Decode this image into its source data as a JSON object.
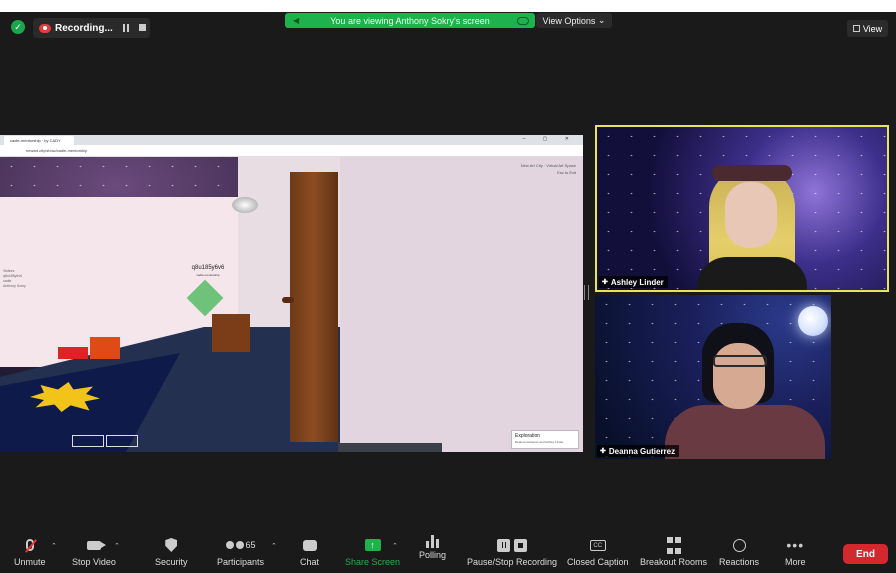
{
  "meeting": {
    "recording_label": "Recording...",
    "view_banner": "You are viewing Anthony Sokry's screen",
    "view_options": "View Options",
    "view_label": "View"
  },
  "shared_screen": {
    "tab_title": "cadie-mentorship · by CADY",
    "url": "newart.city/show/cadie-mentorship",
    "avatar_name": "q8u185y6v6",
    "avatar_sub": "cadie-mentorship",
    "hud_text": "New Art City · Virtual Art Space",
    "hud_sub": "Esc to Exit",
    "left_list": [
      "Visitors",
      "q8u185y6v6",
      "cadie",
      "Anthony Sokry"
    ],
    "exploration_title": "Exploration",
    "exploration_sub": "Deanna Gutierrez and Ashley Linder"
  },
  "participants": [
    {
      "name": "Ashley Linder",
      "active_speaker": true
    },
    {
      "name": "Deanna Gutierrez",
      "active_speaker": false
    }
  ],
  "toolbar": {
    "unmute": "Unmute",
    "stop_video": "Stop Video",
    "security": "Security",
    "participants": "Participants",
    "participant_count": "65",
    "chat": "Chat",
    "share_screen": "Share Screen",
    "polling": "Polling",
    "pause_stop_recording": "Pause/Stop Recording",
    "closed_caption": "Closed Caption",
    "cc_icon_text": "CC",
    "breakout_rooms": "Breakout Rooms",
    "reactions": "Reactions",
    "more": "More",
    "end": "End"
  },
  "colors": {
    "accent_green": "#1eb24c",
    "active_speaker_border": "#e8e45a",
    "end_red": "#d6272e"
  }
}
